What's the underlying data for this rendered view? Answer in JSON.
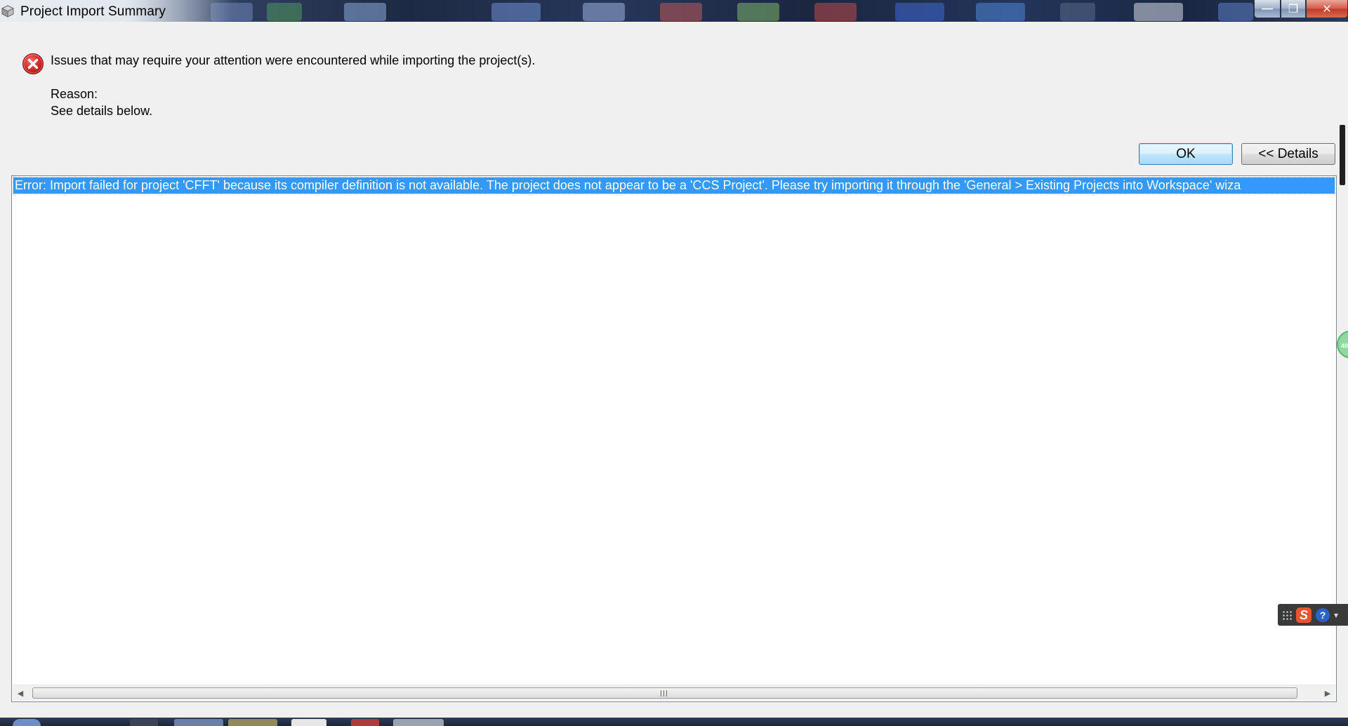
{
  "window": {
    "title": "Project Import Summary",
    "controls": {
      "minimize_icon": "minimize-icon",
      "maximize_icon": "restore-icon",
      "close_icon": "close-icon",
      "minimize_glyph": "—",
      "maximize_glyph": "❒",
      "close_glyph": "✕"
    }
  },
  "dialog": {
    "icon": "error-icon",
    "message": "Issues that may require your attention were encountered while importing the project(s).",
    "reason_label": "Reason:",
    "reason_text": "See details below.",
    "buttons": {
      "ok_label": "OK",
      "details_label": "<< Details"
    }
  },
  "details": {
    "items": [
      "Error: Import failed for project 'CFFT' because its compiler definition is not available. The project does not appear to be a 'CCS Project'. Please try importing it through the 'General > Existing Projects into Workspace' wiza"
    ],
    "selected_index": 0
  },
  "overlays": {
    "ime_toolbar_icons": [
      "keyboard-icon",
      "sogou-s-icon",
      "help-icon",
      "more-icon"
    ],
    "ime_s_glyph": "S",
    "ime_help_glyph": "?",
    "edge_badge_text": "40"
  },
  "colors": {
    "selection": "#3399ff",
    "error_red": "#c8262a",
    "ok_border": "#3c7fb1"
  }
}
